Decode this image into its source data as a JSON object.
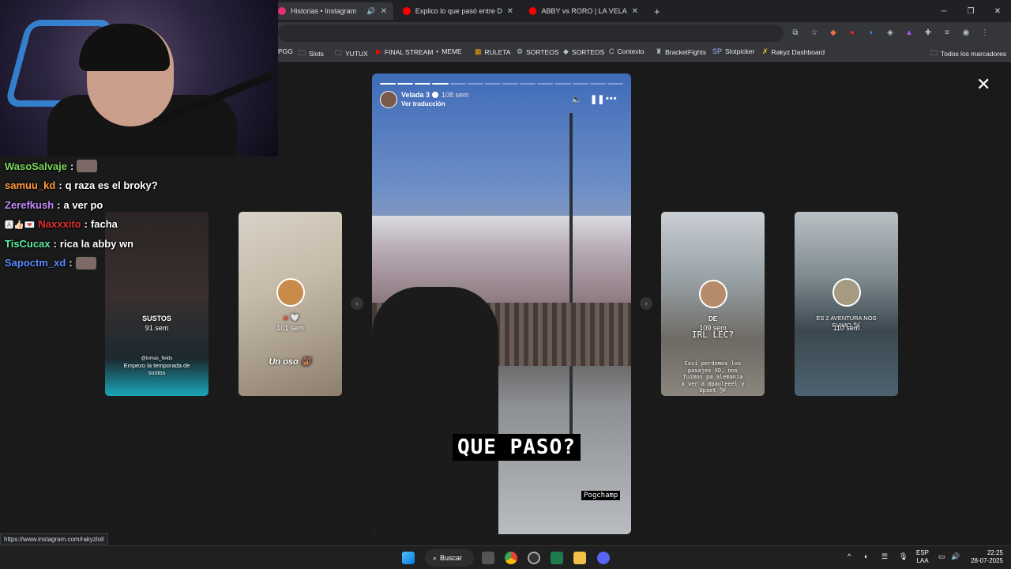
{
  "browser": {
    "tabs": [
      {
        "label": "Historias • Instagram",
        "active": true,
        "color": "#e1306c"
      },
      {
        "label": "Explico lo que pasó entre De La",
        "active": false,
        "color": "#ff0000"
      },
      {
        "label": "ABBY vs RORO | LA VELADA DE",
        "active": false,
        "color": "#ff0000"
      }
    ],
    "new_tab_label": "+",
    "bookmarks": [
      {
        "label": "PGG",
        "icon": "site-icon"
      },
      {
        "label": "Slots",
        "icon": "folder-icon"
      },
      {
        "label": "YUTUX",
        "icon": "folder-icon"
      },
      {
        "label": "FINAL STREAM",
        "icon": "youtube-icon"
      },
      {
        "label": "MEME",
        "icon": "site-icon"
      },
      {
        "label": "RULETA",
        "icon": "site-icon"
      },
      {
        "label": "SORTEOS",
        "icon": "gear-icon"
      },
      {
        "label": "SORTEOS",
        "icon": "diamond-icon"
      },
      {
        "label": "Contexto",
        "icon": "site-icon"
      },
      {
        "label": "BracketFights",
        "icon": "site-icon"
      },
      {
        "label": "Slotpicker",
        "icon": "site-icon"
      },
      {
        "label": "Rakyz Dashboard",
        "icon": "site-icon"
      }
    ],
    "all_bookmarks_label": "Todos los marcadores",
    "status_url": "https://www.instagram.com/rakyzlol/"
  },
  "story": {
    "username": "Velada 3",
    "time": "108 sem",
    "translate_label": "Ver traducción",
    "caption": "QUE PASO?",
    "sticker": "Pogchamp",
    "progress_total": 14,
    "progress_done": 4
  },
  "side_stories": [
    {
      "title": "SUSTOS",
      "time": "91 sem",
      "sub_handle": "@tomas_fields",
      "sub_text": "Empezo la temporada de sustos"
    },
    {
      "title": "",
      "time": "101 sem",
      "emoji_line": "🔺🤍",
      "sub_text": "Un oso 🐻"
    },
    {
      "title": "DE",
      "time": "109 sem",
      "extra": "IRL LEC?",
      "sub_text": "Casi perdemos los pasajes XD, nos fuimos pa alemania a ver a @pauleeel y Upset 🛩"
    },
    {
      "title": "ES 2 AVENTURA NOS FUIMO 🛩",
      "time": "110 sem"
    }
  ],
  "chat": [
    {
      "user": "WasoSalvaje",
      "color": "#7cd85e",
      "text": "",
      "emote": true
    },
    {
      "user": "samuu_kd",
      "color": "#ff9a3c",
      "text": "q raza es el broky?"
    },
    {
      "user": "Zerefkush",
      "color": "#c38bff",
      "text": "a ver po"
    },
    {
      "user": "Naxxxito",
      "color": "#e2302c",
      "text": "facha",
      "badges": true
    },
    {
      "user": "TisCucax",
      "color": "#5ef0a0",
      "text": "rica la abby wn"
    },
    {
      "user": "Sapoctm_xd",
      "color": "#5a8cff",
      "text": "",
      "emote": true
    }
  ],
  "taskbar": {
    "search_label": "Buscar",
    "lang_line1": "ESP",
    "lang_line2": "LAA",
    "time": "22:25",
    "date": "28-07-2025"
  }
}
